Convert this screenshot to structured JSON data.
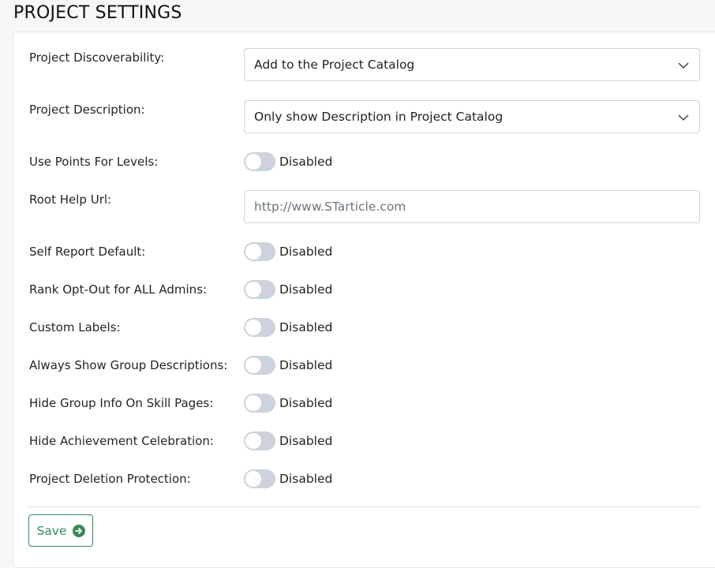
{
  "page": {
    "title": "PROJECT SETTINGS"
  },
  "settings": {
    "discoverability": {
      "label": "Project Discoverability:",
      "value": "Add to the Project Catalog"
    },
    "description": {
      "label": "Project Description:",
      "value": "Only show Description in Project Catalog"
    },
    "points_for_levels": {
      "label": "Use Points For Levels:",
      "state": "Disabled"
    },
    "root_help_url": {
      "label": "Root Help Url:",
      "placeholder": "http://www.STarticle.com"
    },
    "self_report_default": {
      "label": "Self Report Default:",
      "state": "Disabled"
    },
    "rank_opt_out": {
      "label": "Rank Opt-Out for ALL Admins:",
      "state": "Disabled"
    },
    "custom_labels": {
      "label": "Custom Labels:",
      "state": "Disabled"
    },
    "group_descriptions": {
      "label": "Always Show Group Descriptions:",
      "state": "Disabled"
    },
    "hide_group_info": {
      "label": "Hide Group Info On Skill Pages:",
      "state": "Disabled"
    },
    "hide_achievement": {
      "label": "Hide Achievement Celebration:",
      "state": "Disabled"
    },
    "deletion_protection": {
      "label": "Project Deletion Protection:",
      "state": "Disabled"
    }
  },
  "actions": {
    "save_label": "Save"
  },
  "colors": {
    "accent": "#3a8a5a",
    "toggle_off": "#ccd3dc"
  }
}
